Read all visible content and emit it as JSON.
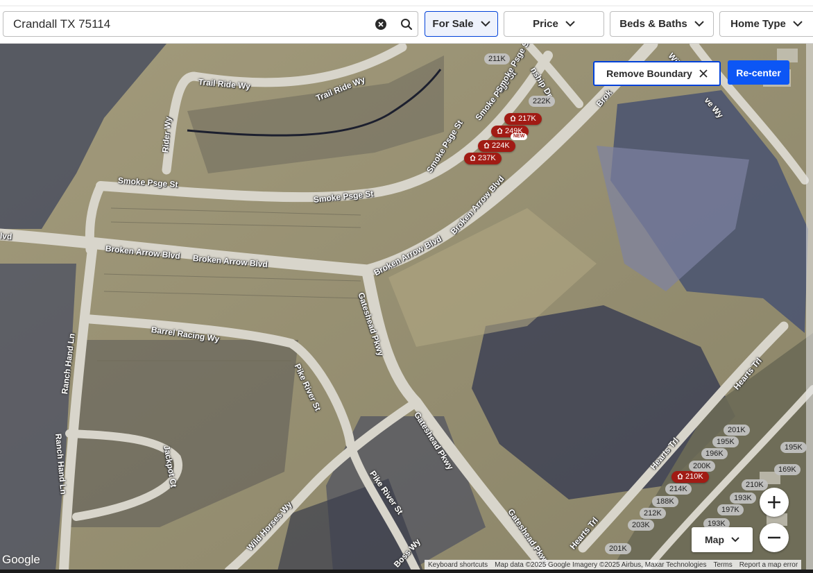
{
  "search": {
    "value": "Crandall TX 75114"
  },
  "filters": {
    "for_sale": "For Sale",
    "price": "Price",
    "beds_baths": "Beds & Baths",
    "home_type": "Home Type"
  },
  "map_controls": {
    "remove_boundary": "Remove Boundary",
    "recenter": "Re-center",
    "map_type": "Map"
  },
  "highlighted_listings": [
    {
      "price": "217K"
    },
    {
      "price": "249K",
      "badge": "NEW"
    },
    {
      "price": "224K"
    },
    {
      "price": "237K"
    },
    {
      "price": "210K"
    }
  ],
  "other_listings": [
    "211K",
    "222K",
    "201K",
    "195K",
    "195K",
    "196K",
    "169K",
    "200K",
    "214K",
    "210K",
    "188K",
    "193K",
    "212K",
    "197K",
    "203K",
    "193K",
    "201K"
  ],
  "streets": {
    "trail_ride_1": "Trail Ride Wy",
    "trail_ride_2": "Trail Ride Wy",
    "rider": "Rider Wy",
    "smoke_1": "Smoke Psge St",
    "smoke_2": "Smoke Psge St",
    "smoke_3": "Smoke Psge St",
    "smoke_4": "Smoke Psge St",
    "smoke_5": "Smoke Psge St",
    "township": "nship Dr",
    "broken_1": "Broken Arrow Blvd",
    "broken_2": "Broken Arrow Blvd",
    "broken_3": "Broken Arrow Blvd",
    "broken_4": "Broken Arrow Blvd",
    "broken_5": "Brok",
    "broken_6": "lvd",
    "barrel": "Barrel Racing Wy",
    "gateshead_1": "Gateshead Pkwy",
    "gateshead_2": "Gateshead Pkwy",
    "gateshead_3": "Gateshead Pkwy",
    "pike_1": "Pike River St",
    "pike_2": "Pike River St",
    "ranch_1": "Ranch Hand Ln",
    "ranch_2": "Ranch Hand Ln",
    "jackpot": "Jackpot Ct",
    "wild_horses": "Wild Horses Wy",
    "boss": "Boss Wy",
    "hearts_1": "Hearts Trl",
    "hearts_2": "Hearts Trl",
    "hearts_3": "Hearts Trl",
    "wildlife": "Wildli",
    "wildlife_2": "ve Wy"
  },
  "map_footer": {
    "logo": "Google",
    "keyboard": "Keyboard shortcuts",
    "data": "Map data ©2025 Google Imagery ©2025 Airbus, Maxar Technologies",
    "terms": "Terms",
    "report": "Report a map error"
  },
  "colors": {
    "listing_marker": "#a11b14",
    "accent_blue": "#0c56f5",
    "filter_active_border": "#0041d9"
  }
}
